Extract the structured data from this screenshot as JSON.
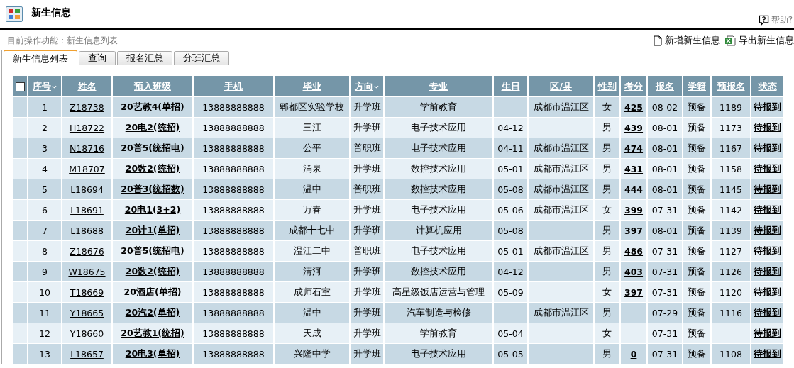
{
  "page": {
    "title": "新生信息",
    "help": "帮助?",
    "breadcrumb": "目前操作功能：新生信息列表"
  },
  "actions": [
    {
      "kind": "new",
      "label": "新增新生信息"
    },
    {
      "kind": "export",
      "label": "导出新生信息"
    }
  ],
  "tabs": [
    {
      "label": "新生信息列表",
      "selected": true
    },
    {
      "label": "查询",
      "selected": false
    },
    {
      "label": "报名汇总",
      "selected": false
    },
    {
      "label": "分班汇总",
      "selected": false
    }
  ],
  "table": {
    "select_all": {
      "checked": false
    },
    "columns": [
      {
        "label": "序号",
        "sortable": true,
        "kind": "plain"
      },
      {
        "label": "姓名",
        "sortable": false,
        "kind": "link"
      },
      {
        "label": "预入班级",
        "sortable": false,
        "kind": "boldlink"
      },
      {
        "label": "手机",
        "sortable": false,
        "kind": "plain"
      },
      {
        "label": "毕业",
        "sortable": false,
        "kind": "plain"
      },
      {
        "label": "方向",
        "sortable": true,
        "kind": "plain"
      },
      {
        "label": "专业",
        "sortable": false,
        "kind": "plain"
      },
      {
        "label": "生日",
        "sortable": false,
        "kind": "plain"
      },
      {
        "label": "区/县",
        "sortable": false,
        "kind": "plain"
      },
      {
        "label": "性别",
        "sortable": false,
        "kind": "plain"
      },
      {
        "label": "考分",
        "sortable": false,
        "kind": "boldlink"
      },
      {
        "label": "报名",
        "sortable": false,
        "kind": "plain"
      },
      {
        "label": "学籍",
        "sortable": false,
        "kind": "plain"
      },
      {
        "label": "预报名",
        "sortable": false,
        "kind": "plain"
      },
      {
        "label": "状态",
        "sortable": false,
        "kind": "boldlink"
      }
    ],
    "rows": [
      [
        "1",
        "Z18738",
        "20艺教4(单招)",
        "13888888888",
        "郫都区实验学校",
        "升学班",
        "学前教育",
        "",
        "成都市温江区",
        "女",
        "425",
        "08-02",
        "预备",
        "1189",
        "待报到"
      ],
      [
        "2",
        "H18722",
        "20电2(统招)",
        "13888888888",
        "三江",
        "升学班",
        "电子技术应用",
        "04-12",
        "",
        "男",
        "439",
        "08-01",
        "预备",
        "1173",
        "待报到"
      ],
      [
        "3",
        "N18716",
        "20普5(统招电)",
        "13888888888",
        "公平",
        "普职班",
        "电子技术应用",
        "04-11",
        "成都市温江区",
        "男",
        "474",
        "08-01",
        "预备",
        "1167",
        "待报到"
      ],
      [
        "4",
        "M18707",
        "20数2(统招)",
        "13888888888",
        "涌泉",
        "升学班",
        "数控技术应用",
        "05-01",
        "成都市温江区",
        "男",
        "431",
        "08-01",
        "预备",
        "1158",
        "待报到"
      ],
      [
        "5",
        "L18694",
        "20普3(统招数)",
        "13888888888",
        "温中",
        "普职班",
        "数控技术应用",
        "05-08",
        "成都市温江区",
        "男",
        "444",
        "08-01",
        "预备",
        "1145",
        "待报到"
      ],
      [
        "6",
        "L18691",
        "20电1(3+2)",
        "13888888888",
        "万春",
        "升学班",
        "电子技术应用",
        "05-06",
        "成都市温江区",
        "女",
        "399",
        "07-31",
        "预备",
        "1142",
        "待报到"
      ],
      [
        "7",
        "L18688",
        "20计1(单招)",
        "13888888888",
        "成都十七中",
        "升学班",
        "计算机应用",
        "05-08",
        "",
        "男",
        "397",
        "08-01",
        "预备",
        "1139",
        "待报到"
      ],
      [
        "8",
        "Z18676",
        "20普5(统招电)",
        "13888888888",
        "温江二中",
        "普职班",
        "电子技术应用",
        "05-01",
        "成都市温江区",
        "男",
        "486",
        "07-31",
        "预备",
        "1127",
        "待报到"
      ],
      [
        "9",
        "W18675",
        "20数2(统招)",
        "13888888888",
        "清河",
        "升学班",
        "数控技术应用",
        "04-12",
        "",
        "男",
        "403",
        "07-31",
        "预备",
        "1126",
        "待报到"
      ],
      [
        "10",
        "T18669",
        "20酒店(单招)",
        "13888888888",
        "成师石室",
        "升学班",
        "高星级饭店运营与管理",
        "05-09",
        "",
        "女",
        "397",
        "07-31",
        "预备",
        "1120",
        "待报到"
      ],
      [
        "11",
        "Y18665",
        "20汽2(单招)",
        "13888888888",
        "温中",
        "升学班",
        "汽车制造与检修",
        "",
        "成都市温江区",
        "男",
        "",
        "07-29",
        "预备",
        "1116",
        "待报到"
      ],
      [
        "12",
        "Y18660",
        "20艺教1(统招)",
        "13888888888",
        "天成",
        "升学班",
        "学前教育",
        "05-04",
        "",
        "女",
        "",
        "07-31",
        "预备",
        "",
        "待报到"
      ],
      [
        "13",
        "L18657",
        "20电3(单招)",
        "13888888888",
        "兴隆中学",
        "升学班",
        "电子技术应用",
        "05-05",
        "",
        "男",
        "0",
        "07-31",
        "预备",
        "1108",
        "待报到"
      ]
    ]
  }
}
